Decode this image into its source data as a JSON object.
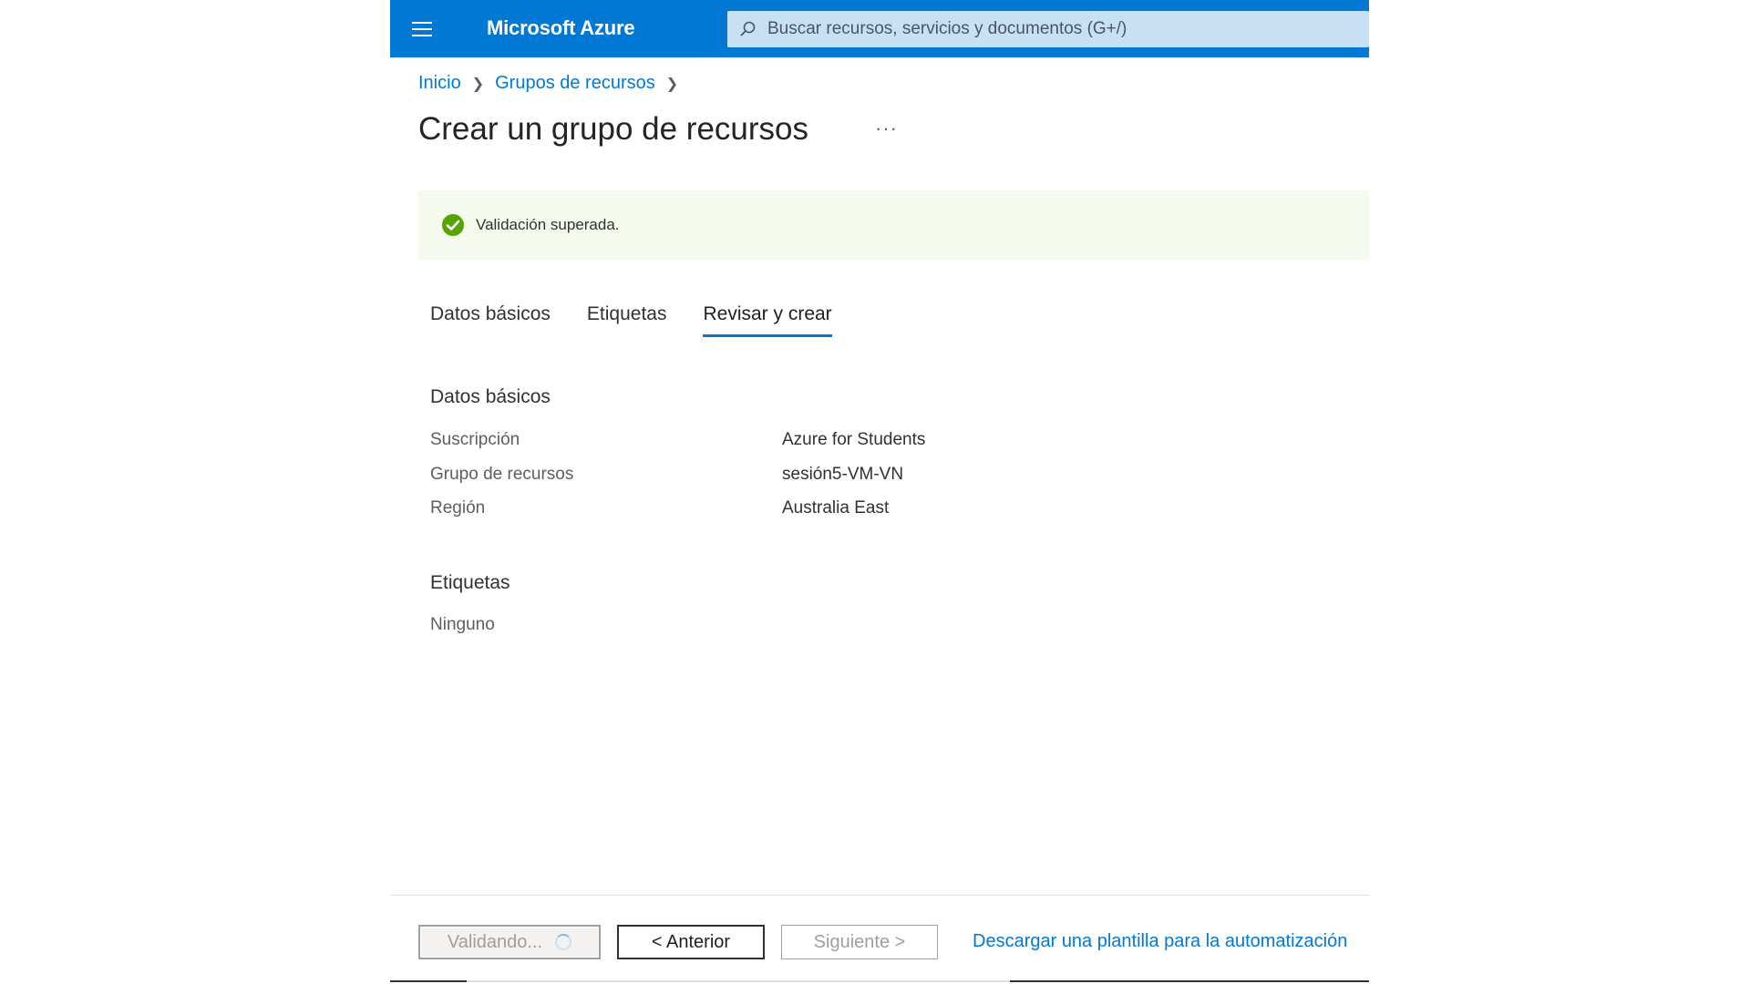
{
  "app": {
    "brand": "Microsoft Azure",
    "accent_color": "#0078d4"
  },
  "search": {
    "placeholder": "Buscar recursos, servicios y documentos (G+/)",
    "icon": "search-icon"
  },
  "breadcrumb": {
    "items": [
      "Inicio",
      "Grupos de recursos"
    ]
  },
  "page": {
    "title": "Crear un grupo de recursos",
    "more": "···"
  },
  "banner": {
    "text": "Validación superada.",
    "icon": "success-check-icon",
    "color": "#57a300"
  },
  "tabs": [
    {
      "label": "Datos básicos",
      "active": false
    },
    {
      "label": "Etiquetas",
      "active": false
    },
    {
      "label": "Revisar y crear",
      "active": true
    }
  ],
  "review": {
    "basics_heading": "Datos básicos",
    "rows": [
      {
        "label": "Suscripción",
        "value": "Azure for Students"
      },
      {
        "label": "Grupo de recursos",
        "value": "sesión5-VM-VN"
      },
      {
        "label": "Región",
        "value": "Australia East"
      }
    ],
    "tags_heading": "Etiquetas",
    "tags_value": "Ninguno"
  },
  "footer": {
    "validating_label": "Validando...",
    "prev_label": "< Anterior",
    "next_label": "Siguiente >",
    "download_link": "Descargar una plantilla para la automatización"
  }
}
